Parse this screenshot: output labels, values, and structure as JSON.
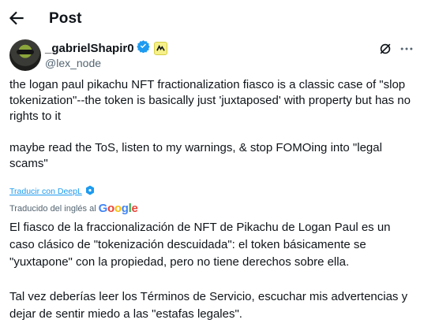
{
  "header": {
    "title": "Post"
  },
  "author": {
    "name": "_gabrielShapir0",
    "handle": "@lex_node"
  },
  "post": {
    "text": "the logan paul pikachu NFT fractionalization fiasco is a classic case of \"slop tokenization\"--the token is basically just 'juxtaposed' with property but has no rights to it\n\nmaybe read the ToS, listen to my warnings, & stop FOMOing into \"legal scams\""
  },
  "deepl": {
    "label": "Traducir con DeepL"
  },
  "translation": {
    "label": "Traducido del inglés al",
    "provider": "Google",
    "text": "El fiasco de la fraccionalización de NFT de Pikachu de Logan Paul es un caso clásico de \"tokenización descuidada\": el token básicamente se \"yuxtapone\" con la propiedad, pero no tiene derechos sobre ella.\n\nTal vez deberías leer los Términos de Servicio, escuchar mis advertencias y dejar de sentir miedo a las \"estafas legales\"."
  },
  "icons": {
    "back": "arrow-left-icon",
    "verified": "verified-badge-icon",
    "affiliate": "affiliate-badge-icon",
    "grok": "grok-icon",
    "more": "more-icon",
    "deepl": "deepl-icon"
  },
  "colors": {
    "accent": "#1d9bf0",
    "text": "#0f1419",
    "muted": "#536471"
  }
}
